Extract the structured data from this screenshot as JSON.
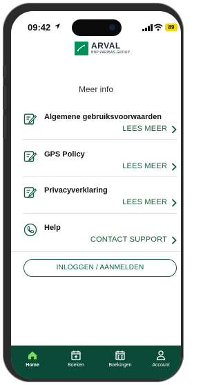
{
  "status": {
    "time": "09:42",
    "battery": "89"
  },
  "logo": {
    "name": "ARVAL",
    "sub": "BNP PARIBAS GROUP"
  },
  "page": {
    "title": "Meer info"
  },
  "items": [
    {
      "title": "Algemene gebruiksvoorwaarden",
      "action": "LEES MEER",
      "icon": "document-edit-icon"
    },
    {
      "title": "GPS Policy",
      "action": "LEES MEER",
      "icon": "document-edit-icon"
    },
    {
      "title": "Privacyverklaring",
      "action": "LEES MEER",
      "icon": "document-edit-icon"
    },
    {
      "title": "Help",
      "action": "CONTACT SUPPORT",
      "icon": "phone-icon"
    }
  ],
  "login": {
    "label": "INLOGGEN / AANMELDEN"
  },
  "tabs": [
    {
      "label": "Home",
      "icon": "home-icon",
      "active": true
    },
    {
      "label": "Boeken",
      "icon": "calendar-plus-icon",
      "active": false
    },
    {
      "label": "Boekingen",
      "icon": "calendar-grid-icon",
      "active": false
    },
    {
      "label": "Account",
      "icon": "user-icon",
      "active": false
    }
  ],
  "colors": {
    "brand_green": "#00915a",
    "dark_green": "#0b4a37",
    "accent_text": "#1d5a3a",
    "battery": "#f4d60a"
  }
}
